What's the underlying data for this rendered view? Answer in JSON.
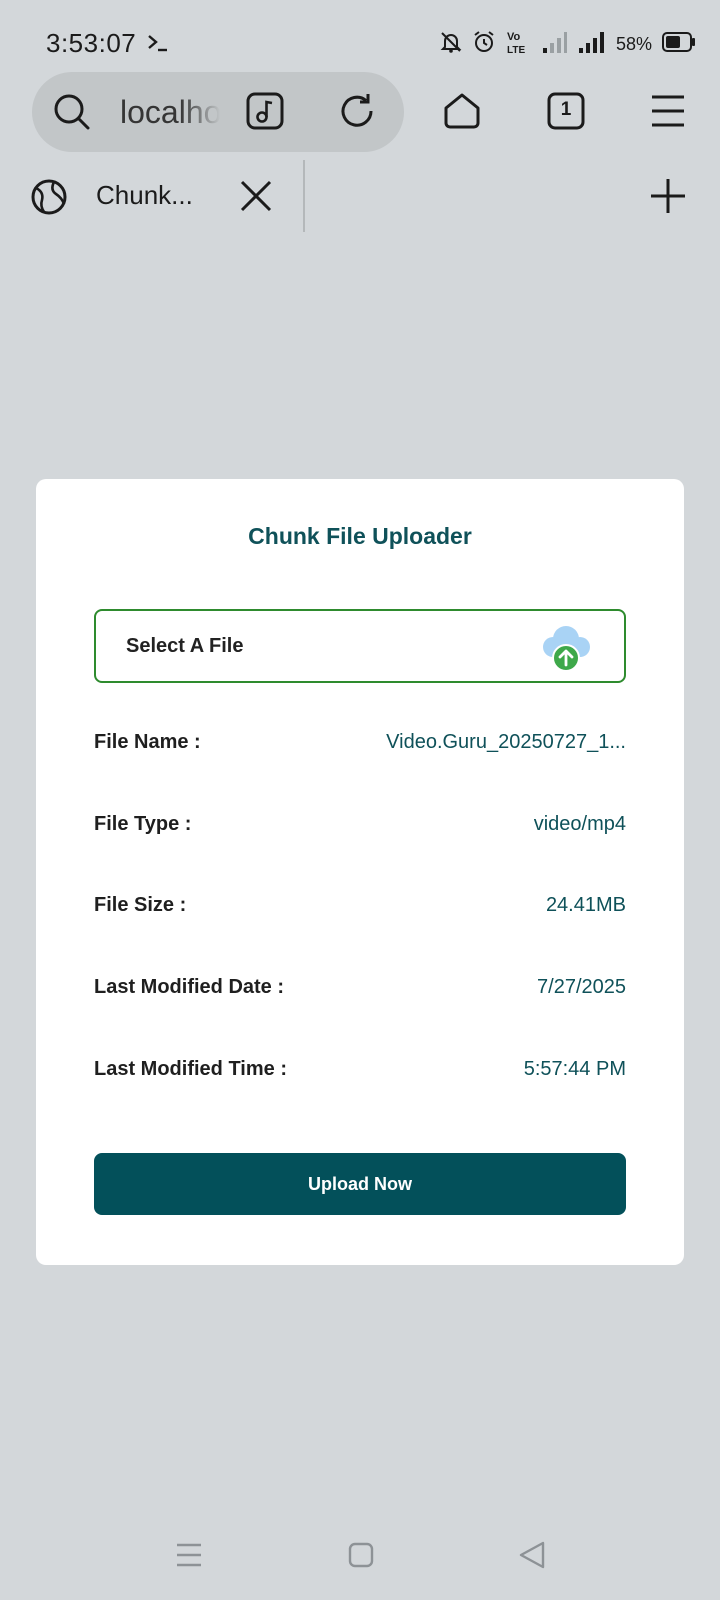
{
  "status_bar": {
    "time": "3:53:07",
    "battery_percent": "58%",
    "network_label": "Vo LTE",
    "icons": [
      "terminal-icon",
      "bell-muted-icon",
      "alarm-icon",
      "volte-icon",
      "signal-weak-icon",
      "signal-icon",
      "battery-icon"
    ]
  },
  "browser": {
    "url_text": "localhost",
    "tab_count": "1",
    "tab_title": "Chunk...",
    "icons": [
      "search-icon",
      "music-icon",
      "reload-icon",
      "home-icon",
      "tabs-icon",
      "menu-icon",
      "globe-icon",
      "close-icon",
      "new-tab-icon"
    ]
  },
  "card": {
    "title": "Chunk File Uploader",
    "select_label": "Select A File",
    "upload_button": "Upload Now",
    "rows": [
      {
        "label": "File Name :",
        "value": "Video.Guru_20250727_1..."
      },
      {
        "label": "File Type :",
        "value": "video/mp4"
      },
      {
        "label": "File Size :",
        "value": "24.41MB"
      },
      {
        "label": "Last Modified Date :",
        "value": "7/27/2025"
      },
      {
        "label": "Last Modified Time :",
        "value": "5:57:44 PM"
      }
    ]
  },
  "nav_bar": {
    "icons": [
      "recents-icon",
      "home-nav-icon",
      "back-icon"
    ]
  },
  "colors": {
    "page_bg": "#d3d7da",
    "accent": "#0f5159",
    "button_bg": "#03505a",
    "select_border": "#2e8b2e",
    "cloud": "#a9d3f5",
    "cloud_badge": "#3ea84a"
  }
}
